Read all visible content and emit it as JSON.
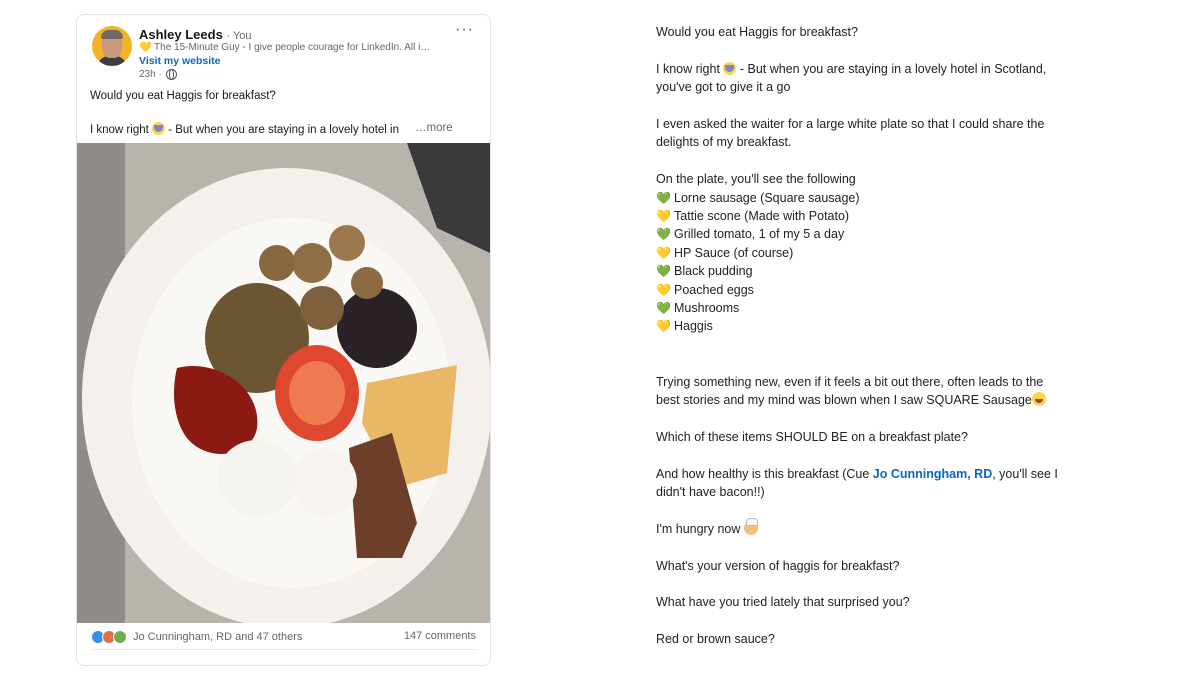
{
  "post": {
    "author_name": "Ashley Leeds",
    "author_badge": "· You",
    "headline": "💛 The 15-Minute Guy - I give people courage for LinkedIn. All i…",
    "website_link": "Visit my website",
    "time_ago": "23h ·",
    "menu_label": "···",
    "intro_line1": "Would you eat Haggis for breakfast?",
    "intro_line2_before": "I know right",
    "intro_line2_after": " - But when you are staying in a lovely hotel in",
    "more_link": "…more",
    "reactions_text": "Jo Cunningham, RD and 47 others",
    "comments_text": "147 comments"
  },
  "full_text": {
    "l1": "Would you eat Haggis for breakfast?",
    "l2a": "I know right",
    "l2b": " - But when you are staying in a lovely hotel in Scotland,",
    "l3": "you've got to give it a go",
    "l4": "I even asked the waiter for a large white plate so that I could share the",
    "l5": "delights of my breakfast.",
    "l6": "On the plate, you'll see the following",
    "items": [
      {
        "heart": "💚",
        "color": "green",
        "text": "Lorne sausage (Square sausage)"
      },
      {
        "heart": "💛",
        "color": "yellow",
        "text": "Tattie scone (Made with Potato)"
      },
      {
        "heart": "💚",
        "color": "green",
        "text": "Grilled tomato, 1 of my 5 a day"
      },
      {
        "heart": "💛",
        "color": "yellow",
        "text": "HP Sauce (of course)"
      },
      {
        "heart": "💚",
        "color": "green",
        "text": "Black pudding"
      },
      {
        "heart": "💛",
        "color": "yellow",
        "text": "Poached eggs"
      },
      {
        "heart": "💚",
        "color": "green",
        "text": "Mushrooms"
      },
      {
        "heart": "💛",
        "color": "yellow",
        "text": "Haggis"
      }
    ],
    "p1": "Trying something new, even if it feels a bit out there, often leads to the",
    "p2": "best stories and my mind was blown when I saw SQUARE Sausage",
    "q1": "Which of these items SHOULD BE on a breakfast plate?",
    "q2a": "And how healthy is this breakfast (Cue ",
    "q2_mention": "Jo Cunningham, RD",
    "q2b": ", you'll see I",
    "q3": "didn't have bacon!!)",
    "hungry": "I'm hungry now",
    "haggis_q": "What's your version of haggis for breakfast?",
    "tried_q": "What have you tried lately that surprised you?",
    "sauce_q": "Red or brown sauce?"
  },
  "colors": {
    "link_blue": "#0a66c2",
    "heart_green": "#2fb84a",
    "heart_yellow": "#f7c531"
  },
  "icons": [
    "avatar-photo",
    "globe-icon",
    "more-menu-icon",
    "screaming-face-emoji",
    "laughing-emoji",
    "chef-emoji",
    "reaction-like-icon",
    "reaction-love-icon",
    "reaction-support-icon"
  ]
}
